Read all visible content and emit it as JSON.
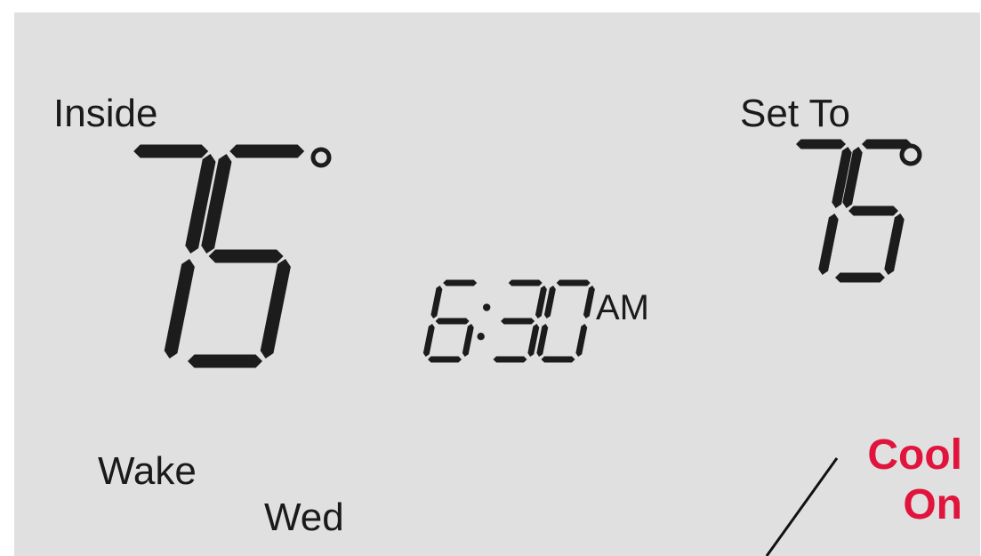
{
  "inside": {
    "label": "Inside",
    "temperature": "75"
  },
  "set_to": {
    "label": "Set To",
    "temperature": "75"
  },
  "clock": {
    "time": "6:30",
    "meridiem": "AM"
  },
  "period": {
    "label": "Wake"
  },
  "day": {
    "label": "Wed"
  },
  "status": {
    "line1": "Cool",
    "line2": "On",
    "color": "#e0143c"
  },
  "colors": {
    "background": "#e0e0e0",
    "segment": "#1c1c1c",
    "page": "#ffffff"
  },
  "icons": {
    "degree_symbol": "degree-icon"
  }
}
